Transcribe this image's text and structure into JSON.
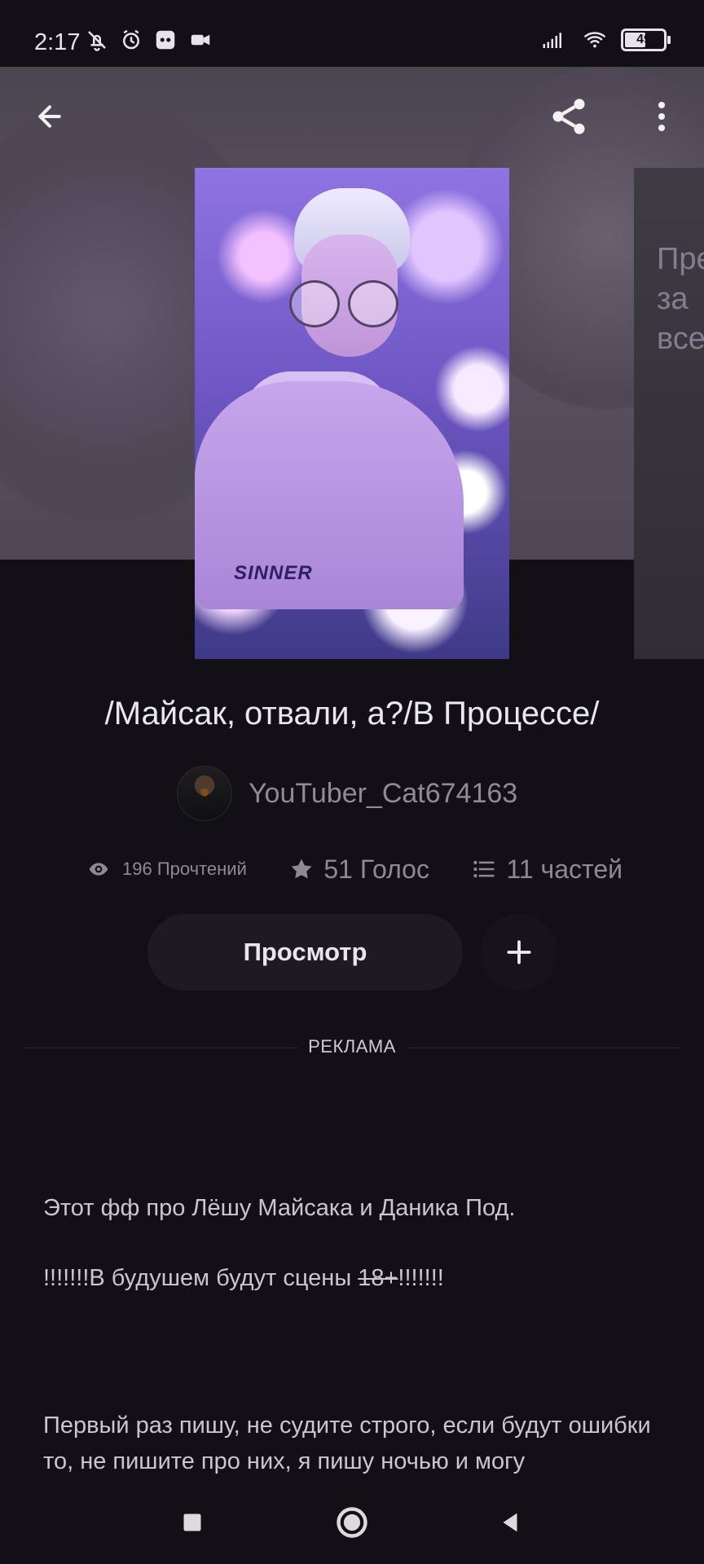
{
  "status": {
    "time": "2:17",
    "battery": "49"
  },
  "book": {
    "title": "/Майсак, отвали, а?/В Процессе/",
    "author": "YouTuber_Cat674163",
    "reads": "196 Прочтений",
    "votes": "51 Голос",
    "parts": "11 частей",
    "view_button": "Просмотр",
    "cover_text": "SINNER"
  },
  "side_card_text": "Пре\nза\nвсе",
  "ad": {
    "label": "РЕКЛАМА"
  },
  "description": {
    "line1": "Этот фф про Лёшу Майсака и Даника Под.",
    "line2_prefix": "!!!!!!!В будушем будут сцены ",
    "line2_strike": "18+",
    "line2_suffix": "!!!!!!!",
    "line3": "Первый раз пишу, не судите строго, если будут ошибки то, не пишите про них, я пишу ночью и могу"
  },
  "colors": {
    "background": "#121015",
    "hero": "#5b5361",
    "button": "#1d1b20",
    "text_primary": "#e9e8ec",
    "text_secondary": "#8d8a93"
  },
  "icons": {
    "back": "arrow-left",
    "share": "share",
    "menu": "more-vertical",
    "reads": "eye",
    "votes": "star",
    "parts": "list",
    "add": "plus",
    "nav_recent": "square",
    "nav_home": "circle",
    "nav_back": "triangle-left"
  }
}
